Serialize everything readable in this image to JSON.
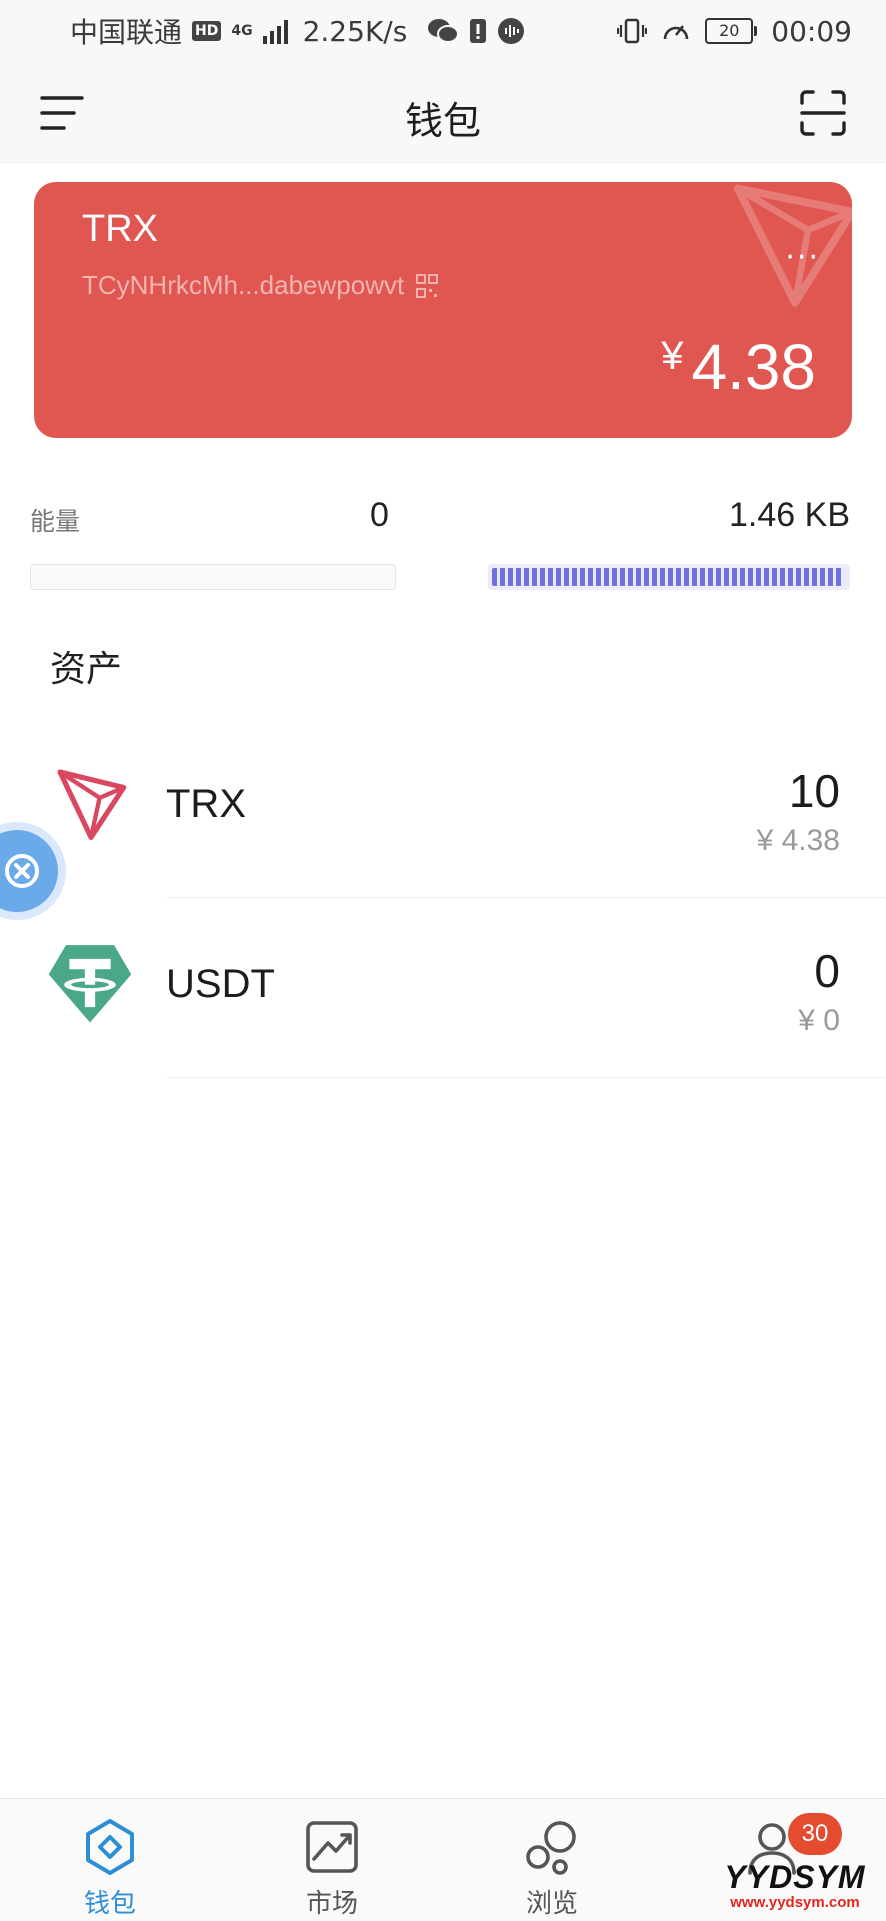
{
  "status_bar": {
    "carrier": "中国联通",
    "hd": "HD",
    "network": "4G",
    "speed": "2.25K/s",
    "battery": "20",
    "time": "00:09"
  },
  "header": {
    "title": "钱包"
  },
  "wallet_card": {
    "name": "TRX",
    "address": "TCyNHrkcMh...dabewpowvt",
    "more": "···",
    "currency_symbol": "¥",
    "balance": "4.38",
    "color": "#e05752"
  },
  "resources": {
    "energy_label": "能量",
    "energy_value": "0",
    "bandwidth_value": "1.46 KB",
    "bandwidth_fill_fraction": 0.99
  },
  "assets": {
    "title": "资产",
    "items": [
      {
        "name": "TRX",
        "amount": "10",
        "value": "¥ 4.38",
        "icon": "tron-logo-icon"
      },
      {
        "name": "USDT",
        "amount": "0",
        "value": "¥ 0",
        "icon": "tether-logo-icon"
      }
    ]
  },
  "tab_bar": {
    "tabs": [
      {
        "label": "钱包",
        "icon": "wallet-icon",
        "active": true
      },
      {
        "label": "市场",
        "icon": "market-chart-icon",
        "active": false
      },
      {
        "label": "浏览",
        "icon": "browse-bubbles-icon",
        "active": false
      },
      {
        "label": "",
        "icon": "profile-icon",
        "active": false
      }
    ],
    "profile_badge": "30",
    "accent_color": "#2c8fd6"
  },
  "watermark": {
    "brand": "YYDSYM",
    "url": "www.yydsym.com"
  }
}
